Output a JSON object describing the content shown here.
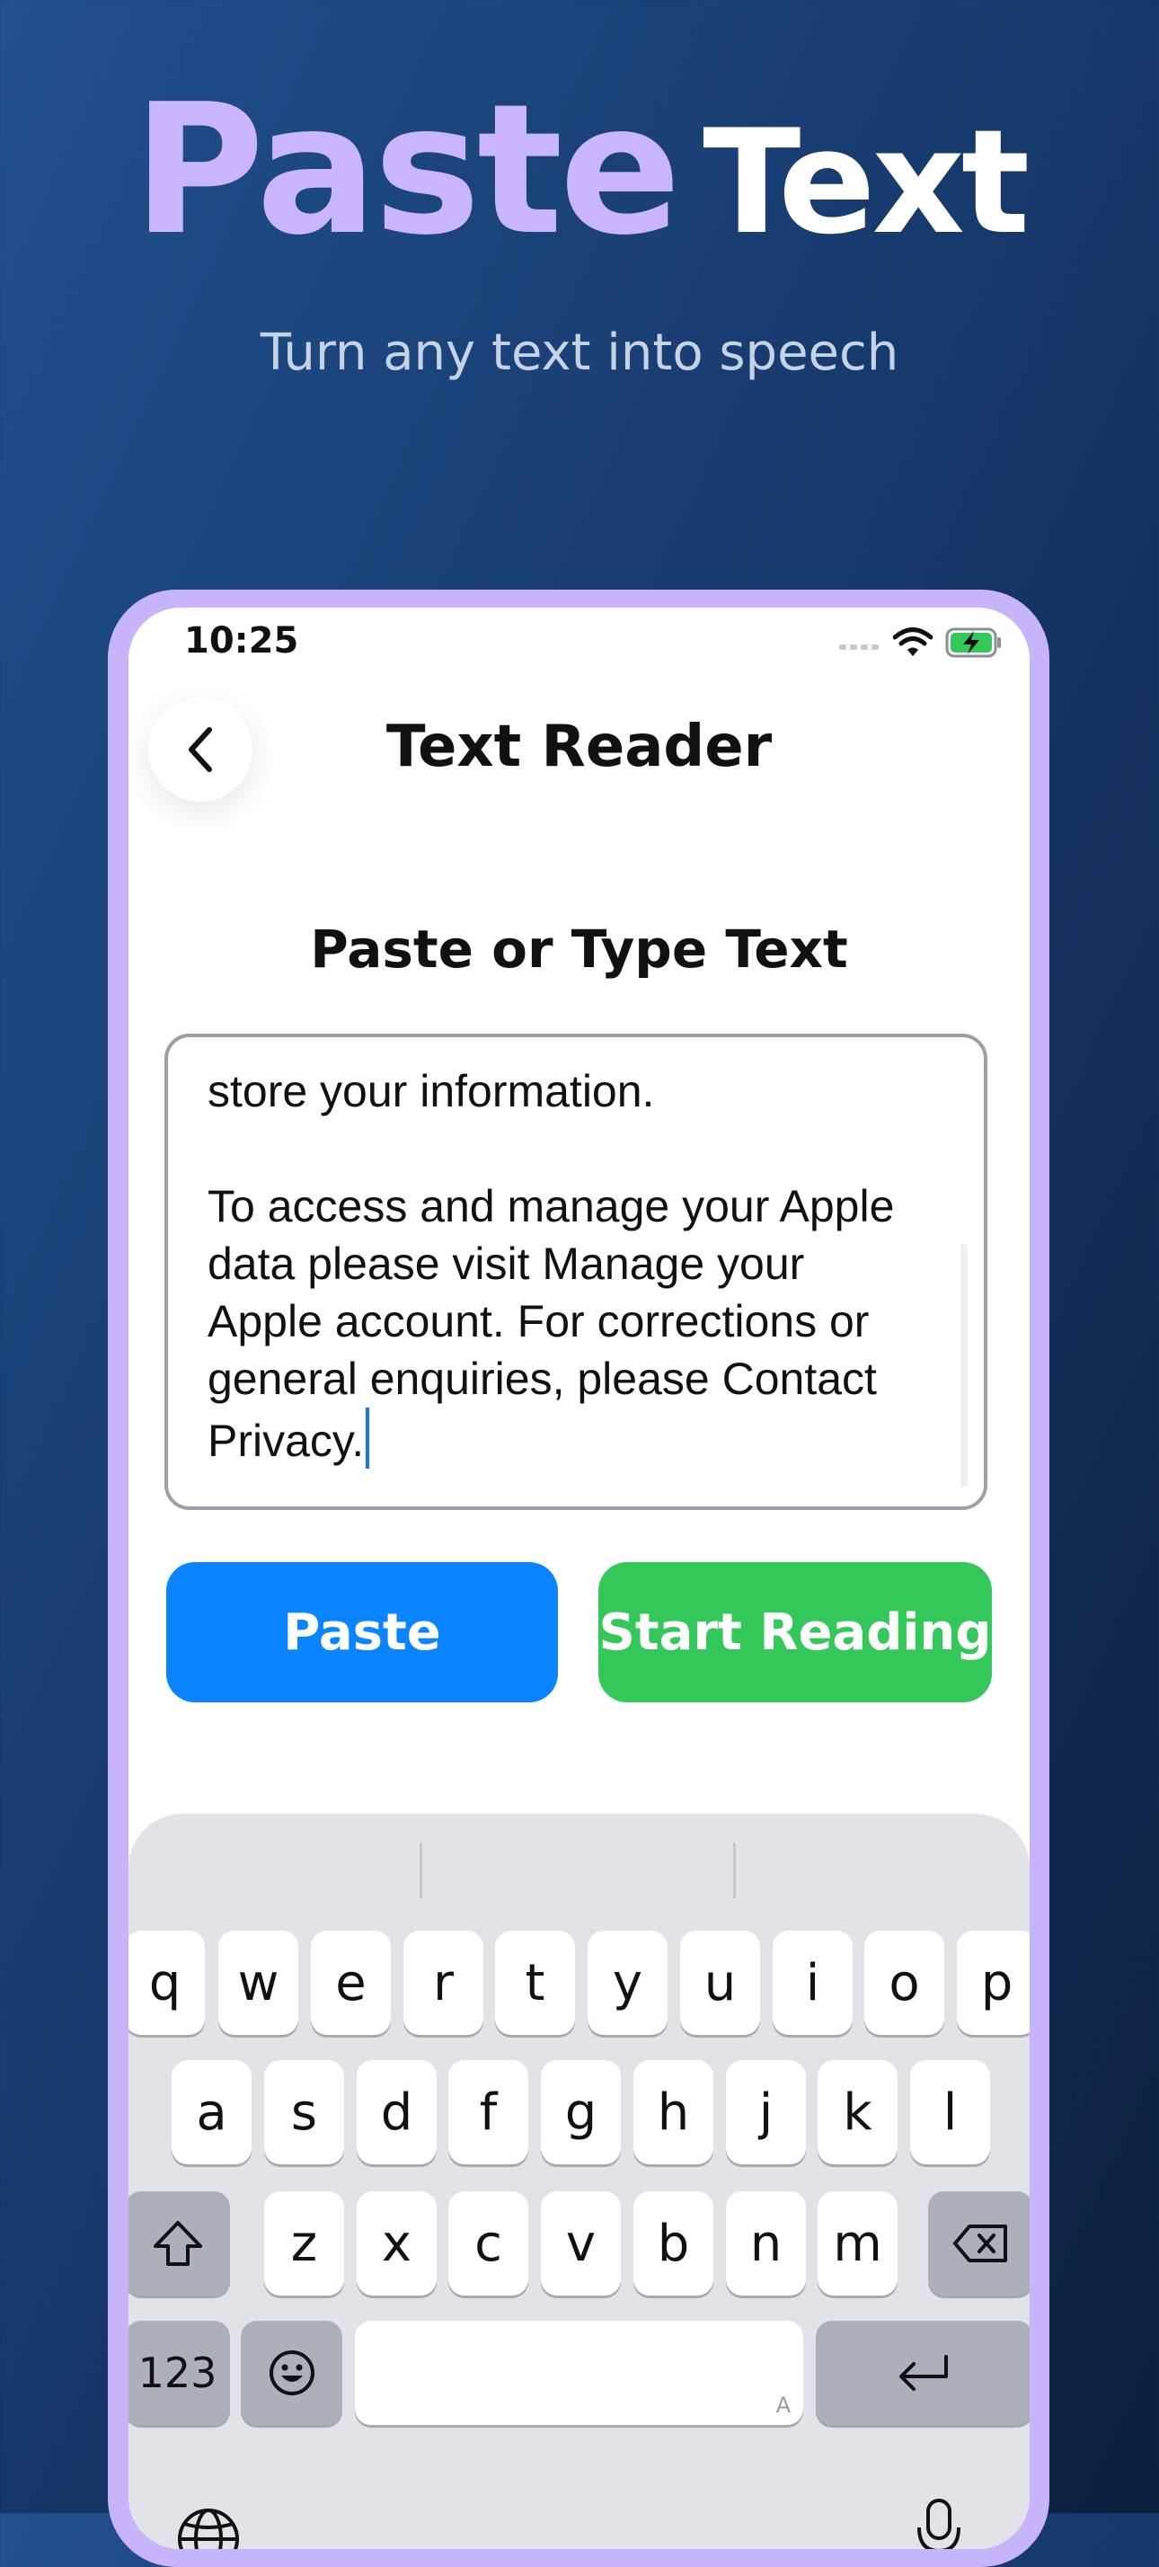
{
  "hero": {
    "title_accent": "Paste",
    "title_main": "Text",
    "subtitle": "Turn any text into speech"
  },
  "status_bar": {
    "time": "10:25"
  },
  "nav": {
    "title": "Text Reader"
  },
  "section": {
    "title": "Paste or Type Text"
  },
  "text_input": {
    "lines": [
      "store your information.",
      "",
      "To access and manage your Apple",
      "data please visit Manage your",
      "Apple account. For corrections or",
      "general enquiries, please Contact",
      "Privacy."
    ]
  },
  "actions": {
    "paste_label": "Paste",
    "start_label": "Start Reading"
  },
  "keyboard": {
    "row1": [
      "q",
      "w",
      "e",
      "r",
      "t",
      "y",
      "u",
      "i",
      "o",
      "p"
    ],
    "row2": [
      "a",
      "s",
      "d",
      "f",
      "g",
      "h",
      "j",
      "k",
      "l"
    ],
    "row3": [
      "z",
      "x",
      "c",
      "v",
      "b",
      "n",
      "m"
    ],
    "numbers_label": "123",
    "space_hint": "A"
  },
  "colors": {
    "paste_button": "#0a84ff",
    "start_button": "#34c759",
    "frame": "#c7b4fb",
    "accent_title": "#c9b6ff"
  }
}
